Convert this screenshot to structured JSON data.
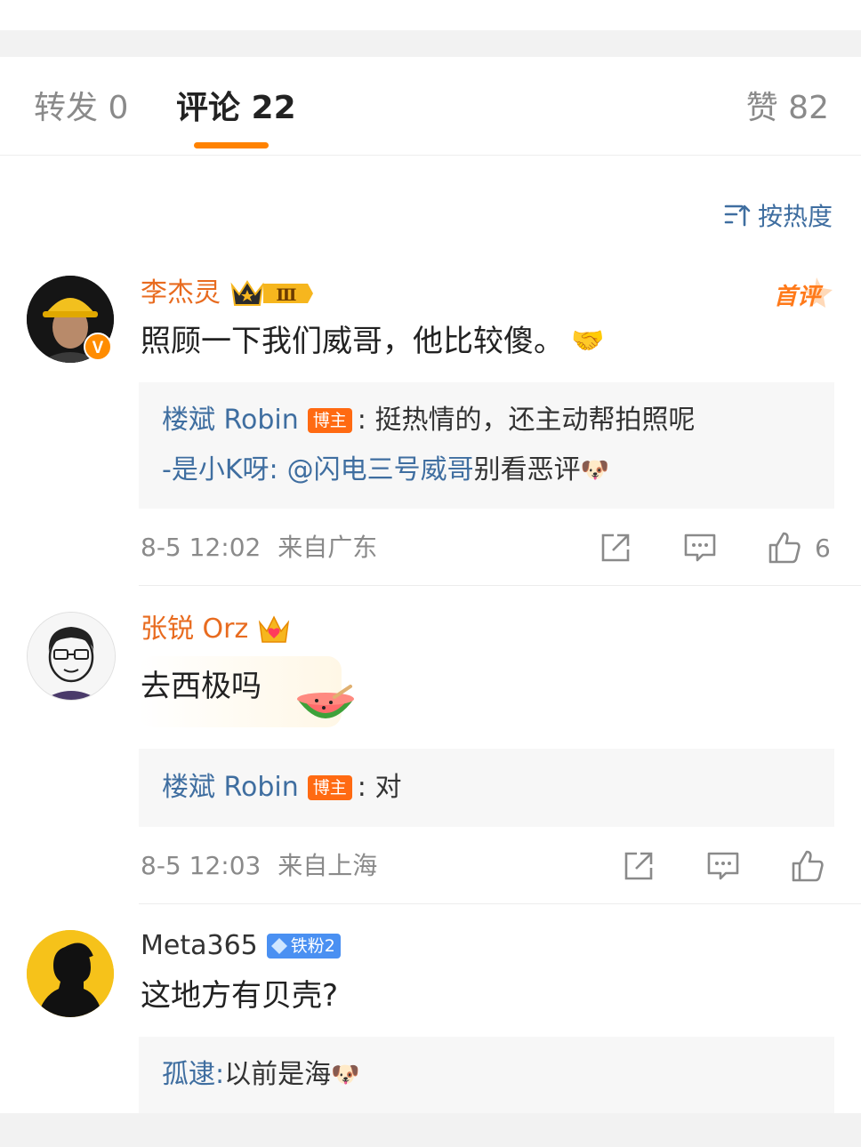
{
  "tabs": {
    "repost": "转发 0",
    "comments": "评论 22",
    "likes": "赞 82"
  },
  "sort": {
    "label": "按热度",
    "icon": "sort-icon"
  },
  "comments": [
    {
      "user": "李杰灵",
      "badge": "Ⅲ",
      "first_tag": "首评",
      "text": "照顾一下我们威哥，他比较傻。",
      "emoji": "🤝",
      "replies": [
        {
          "name": "楼斌 Robin",
          "tag": "博主",
          "text": ": 挺热情的，还主动帮拍照呢"
        },
        {
          "name": "-是小K呀:",
          "mention": "@闪电三号威哥",
          "text": " 别看恶评",
          "emoji": "🐶"
        }
      ],
      "time": "8-5 12:02",
      "location": "来自广东",
      "like_count": "6",
      "verified": "V"
    },
    {
      "user": "张锐 Orz",
      "text": "去西极吗",
      "replies": [
        {
          "name": "楼斌 Robin",
          "tag": "博主",
          "text": ": 对"
        }
      ],
      "time": "8-5 12:03",
      "location": "来自上海"
    },
    {
      "user": "Meta365",
      "fan_badge": "铁粉2",
      "text": "这地方有贝壳?",
      "replies": [
        {
          "name": "孤逮:",
          "text": " 以前是海",
          "emoji": "🐶"
        }
      ]
    }
  ],
  "colors": {
    "accent": "#ff8200",
    "link": "#3f6ea0",
    "name_orange": "#e86b1f"
  }
}
